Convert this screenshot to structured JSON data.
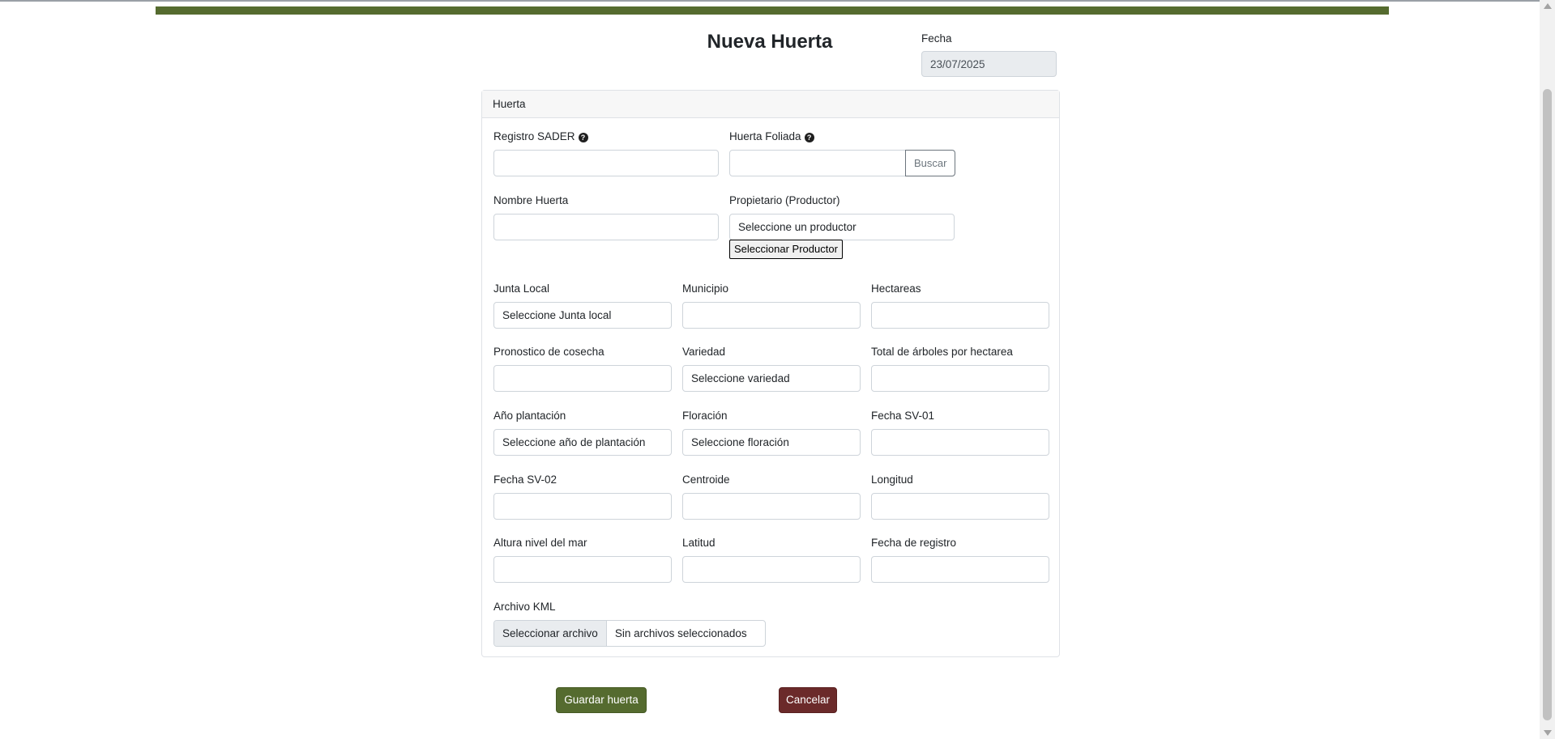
{
  "title": "Nueva Huerta",
  "fecha": {
    "label": "Fecha",
    "value": "23/07/2025"
  },
  "card": {
    "header": "Huerta"
  },
  "fields": {
    "registro_sader": {
      "label": "Registro SADER"
    },
    "huerta_foliada": {
      "label": "Huerta Foliada",
      "button": "Buscar"
    },
    "nombre_huerta": {
      "label": "Nombre Huerta"
    },
    "propietario": {
      "label": "Propietario (Productor)",
      "value": "Seleccione un productor",
      "button": "Seleccionar Productor"
    },
    "junta_local": {
      "label": "Junta Local",
      "value": "Seleccione Junta local"
    },
    "municipio": {
      "label": "Municipio"
    },
    "hectareas": {
      "label": "Hectareas"
    },
    "pronostico": {
      "label": "Pronostico de cosecha"
    },
    "variedad": {
      "label": "Variedad",
      "value": "Seleccione variedad"
    },
    "total_arboles": {
      "label": "Total de árboles por hectarea"
    },
    "anio_plantacion": {
      "label": "Año plantación",
      "value": "Seleccione año de plantación"
    },
    "floracion": {
      "label": "Floración",
      "value": "Seleccione floración"
    },
    "fecha_sv01": {
      "label": "Fecha SV-01"
    },
    "fecha_sv02": {
      "label": "Fecha SV-02"
    },
    "centroide": {
      "label": "Centroide"
    },
    "longitud": {
      "label": "Longitud"
    },
    "altura": {
      "label": "Altura nivel del mar"
    },
    "latitud": {
      "label": "Latitud"
    },
    "fecha_registro": {
      "label": "Fecha de registro"
    },
    "archivo_kml": {
      "label": "Archivo KML",
      "button": "Seleccionar archivo",
      "status": "Sin archivos seleccionados"
    }
  },
  "actions": {
    "save": "Guardar huerta",
    "cancel": "Cancelar"
  },
  "colors": {
    "accent": "#556b2f",
    "cancel": "#6b2a2a"
  }
}
